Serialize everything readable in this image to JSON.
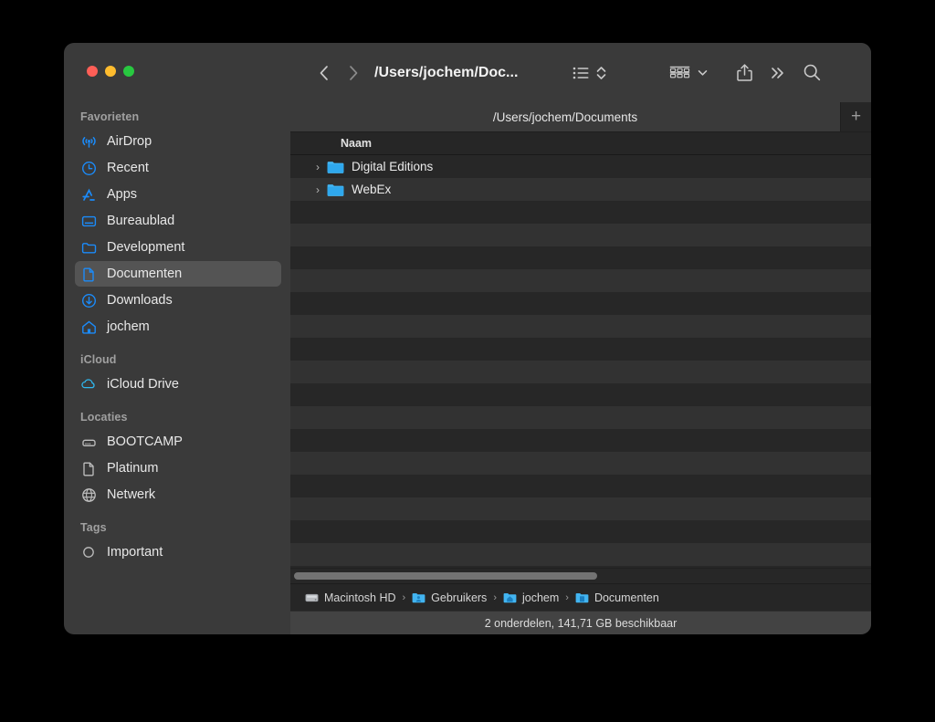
{
  "window": {
    "traffic_lights": [
      {
        "name": "close",
        "color": "#ff5f57"
      },
      {
        "name": "minimize",
        "color": "#febc2e"
      },
      {
        "name": "zoom",
        "color": "#28c840"
      }
    ]
  },
  "toolbar": {
    "back_icon": "chevron-left",
    "forward_icon": "chevron-right",
    "title": "/Users/jochem/Doc...",
    "view_list_icon": "list-view-icon",
    "sort_stepper_icon": "up-down-chevron",
    "group_icon": "grid-view-icon",
    "group_chevron_icon": "chevron-down",
    "share_icon": "share-icon",
    "more_icon": "double-chevron-right",
    "search_icon": "search-icon"
  },
  "tabbar": {
    "active_tab_label": "/Users/jochem/Documents",
    "new_tab_label": "+"
  },
  "sidebar": {
    "sections": [
      {
        "title": "Favorieten",
        "items": [
          {
            "label": "AirDrop",
            "icon": "airdrop-icon",
            "selected": false
          },
          {
            "label": "Recent",
            "icon": "clock-icon",
            "selected": false
          },
          {
            "label": "Apps",
            "icon": "apps-icon",
            "selected": false
          },
          {
            "label": "Bureaublad",
            "icon": "desktop-icon",
            "selected": false
          },
          {
            "label": "Development",
            "icon": "folder-icon",
            "selected": false
          },
          {
            "label": "Documenten",
            "icon": "document-icon",
            "selected": true
          },
          {
            "label": "Downloads",
            "icon": "download-icon",
            "selected": false
          },
          {
            "label": "jochem",
            "icon": "home-icon",
            "selected": false
          }
        ]
      },
      {
        "title": "iCloud",
        "items": [
          {
            "label": "iCloud Drive",
            "icon": "cloud-icon",
            "selected": false
          }
        ]
      },
      {
        "title": "Locaties",
        "items": [
          {
            "label": "BOOTCAMP",
            "icon": "drive-icon",
            "selected": false
          },
          {
            "label": "Platinum",
            "icon": "document-gray-icon",
            "selected": false
          },
          {
            "label": "Netwerk",
            "icon": "globe-icon",
            "selected": false
          }
        ]
      },
      {
        "title": "Tags",
        "items": [
          {
            "label": "Important",
            "icon": "tag-circle-icon",
            "selected": false
          }
        ]
      }
    ]
  },
  "filelist": {
    "columns": [
      "Naam"
    ],
    "rows": [
      {
        "name": "Digital Editions",
        "icon": "folder-icon",
        "expandable": true,
        "disclosure": "›"
      },
      {
        "name": "WebEx",
        "icon": "folder-icon",
        "expandable": true,
        "disclosure": "›"
      }
    ],
    "empty_row_count": 16
  },
  "pathbar": {
    "crumbs": [
      {
        "label": "Macintosh HD",
        "icon": "harddisk-icon"
      },
      {
        "label": "Gebruikers",
        "icon": "users-folder-icon"
      },
      {
        "label": "jochem",
        "icon": "home-folder-icon"
      },
      {
        "label": "Documenten",
        "icon": "documents-folder-icon"
      }
    ],
    "separator": "›"
  },
  "statusbar": {
    "text": "2 onderdelen, 141,71 GB beschikbaar"
  },
  "colors": {
    "accent_blue": "#1b8bf9",
    "folder_blue": "#3bb1f0",
    "window_chrome": "#3a3a3a",
    "list_row_dark": "#272727",
    "list_row_light": "#323232",
    "selection": "#545454"
  }
}
